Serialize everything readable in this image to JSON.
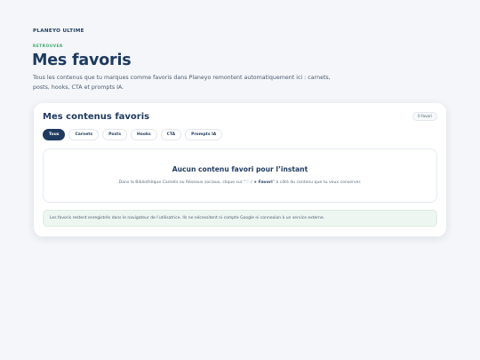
{
  "header": {
    "brand": "PLANEYO ULTIME",
    "eyebrow": "RETROUVER",
    "title": "Mes favoris",
    "intro": "Tous les contenus que tu marques comme favoris dans Planeyo remontent automatiquement ici : carnets, posts, hooks, CTA et prompts IA."
  },
  "card": {
    "title": "Mes contenus favoris",
    "count_badge": "0 favori",
    "tabs": [
      {
        "label": "Tous",
        "active": true
      },
      {
        "label": "Carnets",
        "active": false
      },
      {
        "label": "Posts",
        "active": false
      },
      {
        "label": "Hooks",
        "active": false
      },
      {
        "label": "CTA",
        "active": false
      },
      {
        "label": "Prompts IA",
        "active": false
      }
    ],
    "empty_state": {
      "title": "Aucun contenu favori pour l’instant",
      "desc_before": "Dans la Bibliothèque Carnets ou Réseaux sociaux, clique sur “♡ / ★ ",
      "desc_bold": "Favori",
      "desc_after": "” à côté du contenu que tu veux conserver."
    },
    "notice": "Les favoris restent enregistrés dans le navigateur de l’utilisatrice. Ils ne nécessitent ni compte Google ni connexion à un service externe."
  },
  "colors": {
    "primary": "#1e3a5f",
    "accent_green": "#3aa56b",
    "background": "#f4f6f9",
    "notice_bg": "#eef6f1"
  }
}
